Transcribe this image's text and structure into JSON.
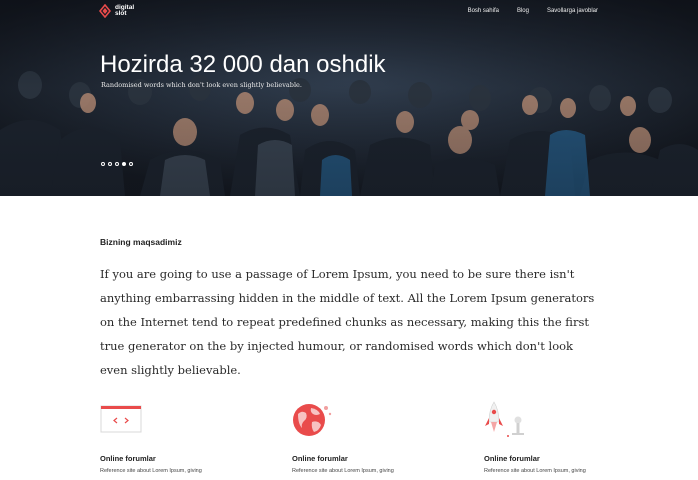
{
  "brand": {
    "name": "digital\nslot",
    "accent": "#e94b4b"
  },
  "nav": {
    "items": [
      {
        "label": "Bosh sahifa"
      },
      {
        "label": "Blog"
      },
      {
        "label": "Savollarga javoblar"
      }
    ]
  },
  "hero": {
    "title": "Hozirda 32 000 dan oshdik",
    "subtitle": "Randomised words which don't look even slightly believable.",
    "slides_total": 5,
    "active_slide": 4
  },
  "goal": {
    "label": "Bizning maqsadimiz",
    "text": "If you are going to use a passage of Lorem Ipsum, you need to be sure there isn't anything embarrassing hidden in the middle of text. All the Lorem Ipsum generators on the Internet tend to repeat predefined chunks as necessary, making this the first true generator on the by injected humour, or randomised words which don't look even slightly believable."
  },
  "features": [
    {
      "icon": "code-window-icon",
      "title": "Online forumlar",
      "description": "Reference site about Lorem Ipsum, giving"
    },
    {
      "icon": "globe-icon",
      "title": "Online forumlar",
      "description": "Reference site about Lorem Ipsum, giving"
    },
    {
      "icon": "rocket-icon",
      "title": "Online forumlar",
      "description": "Reference site about Lorem Ipsum, giving"
    }
  ]
}
